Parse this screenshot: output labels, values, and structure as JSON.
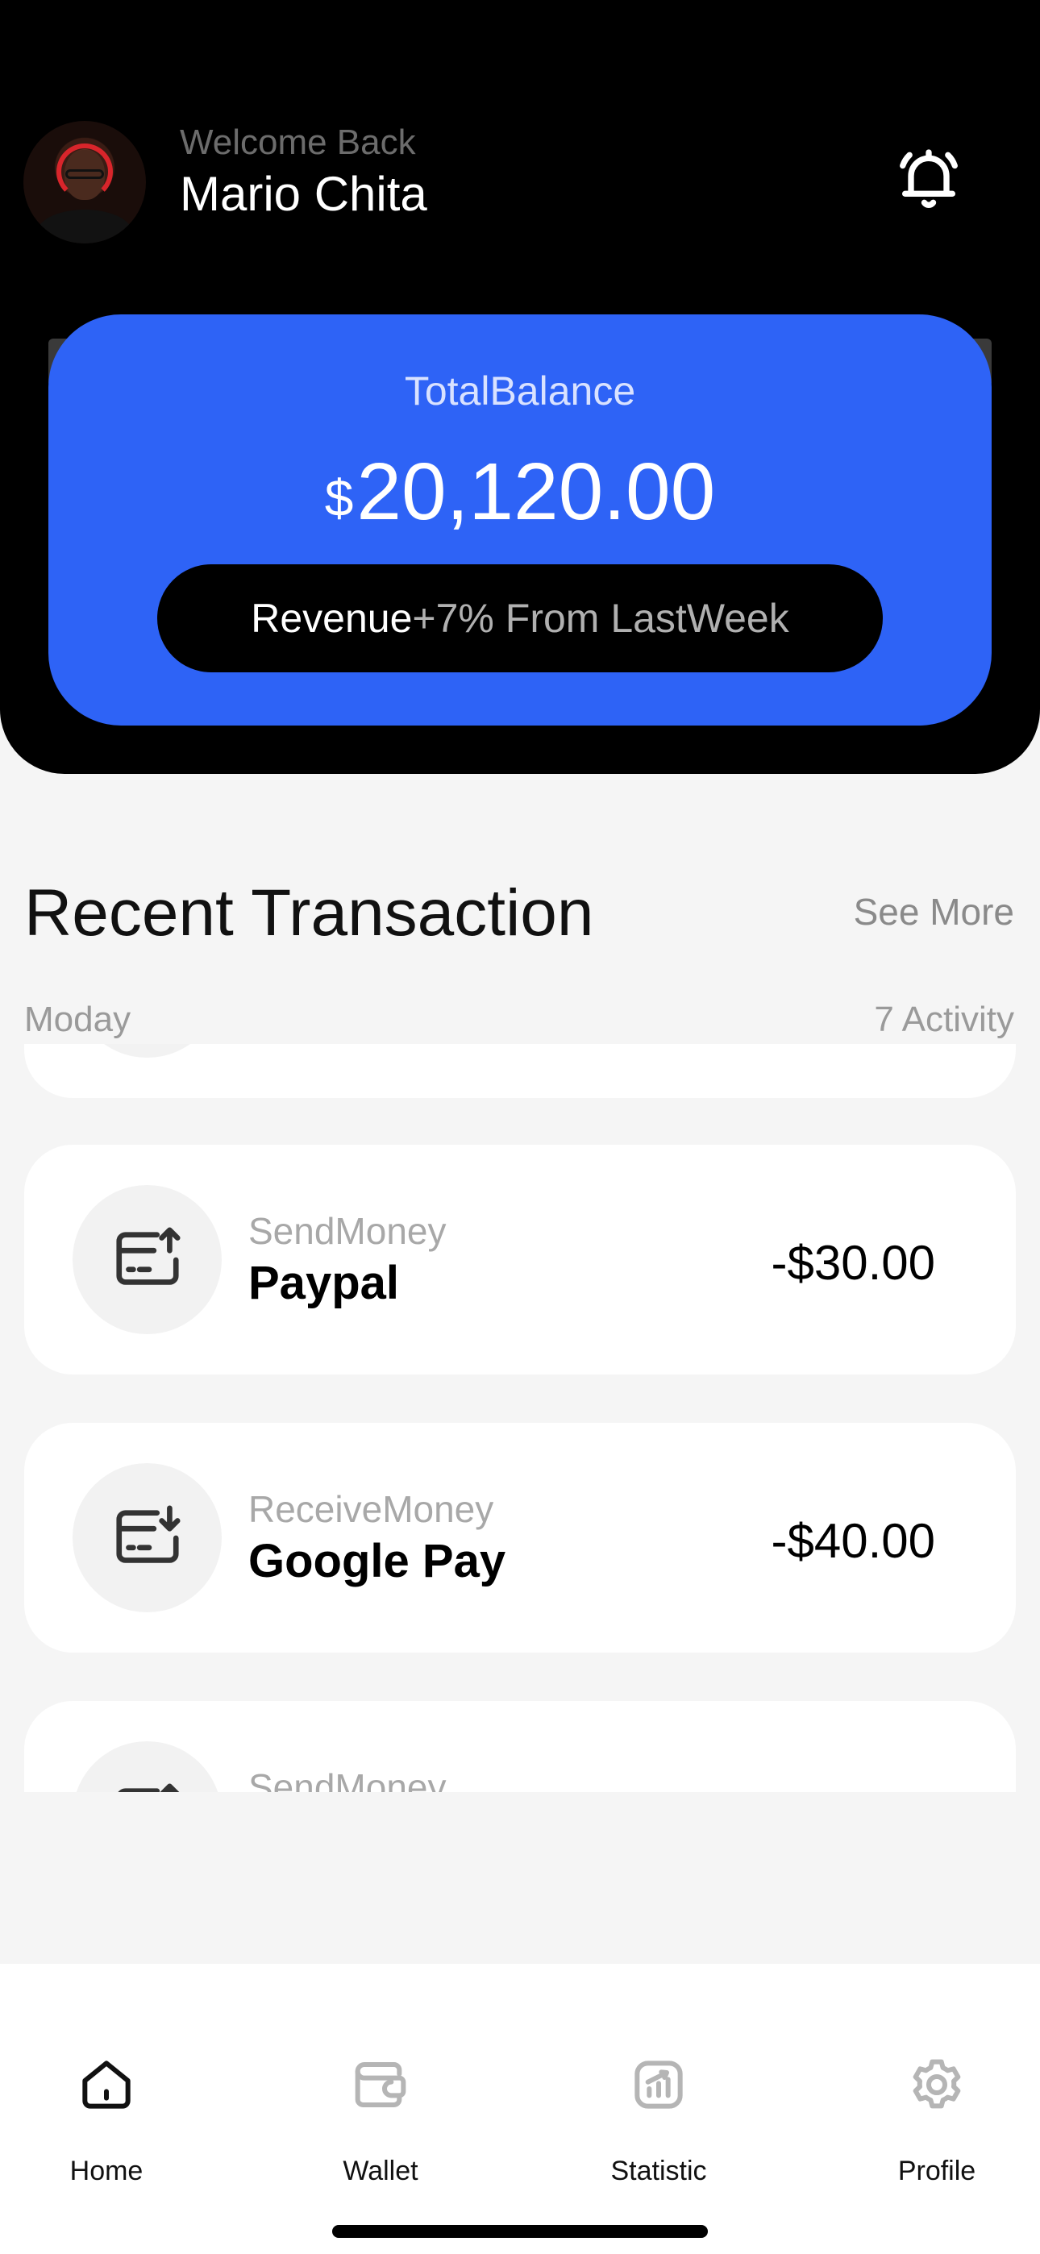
{
  "header": {
    "welcome_text": "Welcome Back",
    "user_name": "Mario Chita"
  },
  "balance": {
    "label": "TotalBalance",
    "currency": "$",
    "amount": "20,120.00",
    "revenue_label": "Revenue",
    "revenue_value": "+7% From LastWeek"
  },
  "transactions": {
    "title": "Recent Transaction",
    "see_more": "See More",
    "day": "Moday",
    "activity_count": "7 Activity",
    "items": [
      {
        "type": "SendMoney",
        "name": "Paypal",
        "amount": "-$30.00",
        "icon": "card-send-icon"
      },
      {
        "type": "ReceiveMoney",
        "name": "Google Pay",
        "amount": "-$40.00",
        "icon": "card-receive-icon"
      },
      {
        "type": "SendMoney",
        "name": "",
        "amount": "",
        "icon": "card-send-icon"
      }
    ]
  },
  "nav": {
    "items": [
      {
        "label": "Home",
        "icon": "home-icon",
        "active": true
      },
      {
        "label": "Wallet",
        "icon": "wallet-icon",
        "active": false
      },
      {
        "label": "Statistic",
        "icon": "statistic-icon",
        "active": false
      },
      {
        "label": "Profile",
        "icon": "gear-icon",
        "active": false
      }
    ]
  },
  "colors": {
    "accent": "#2e63f6",
    "header_bg": "#000000",
    "page_bg": "#f5f5f5"
  }
}
